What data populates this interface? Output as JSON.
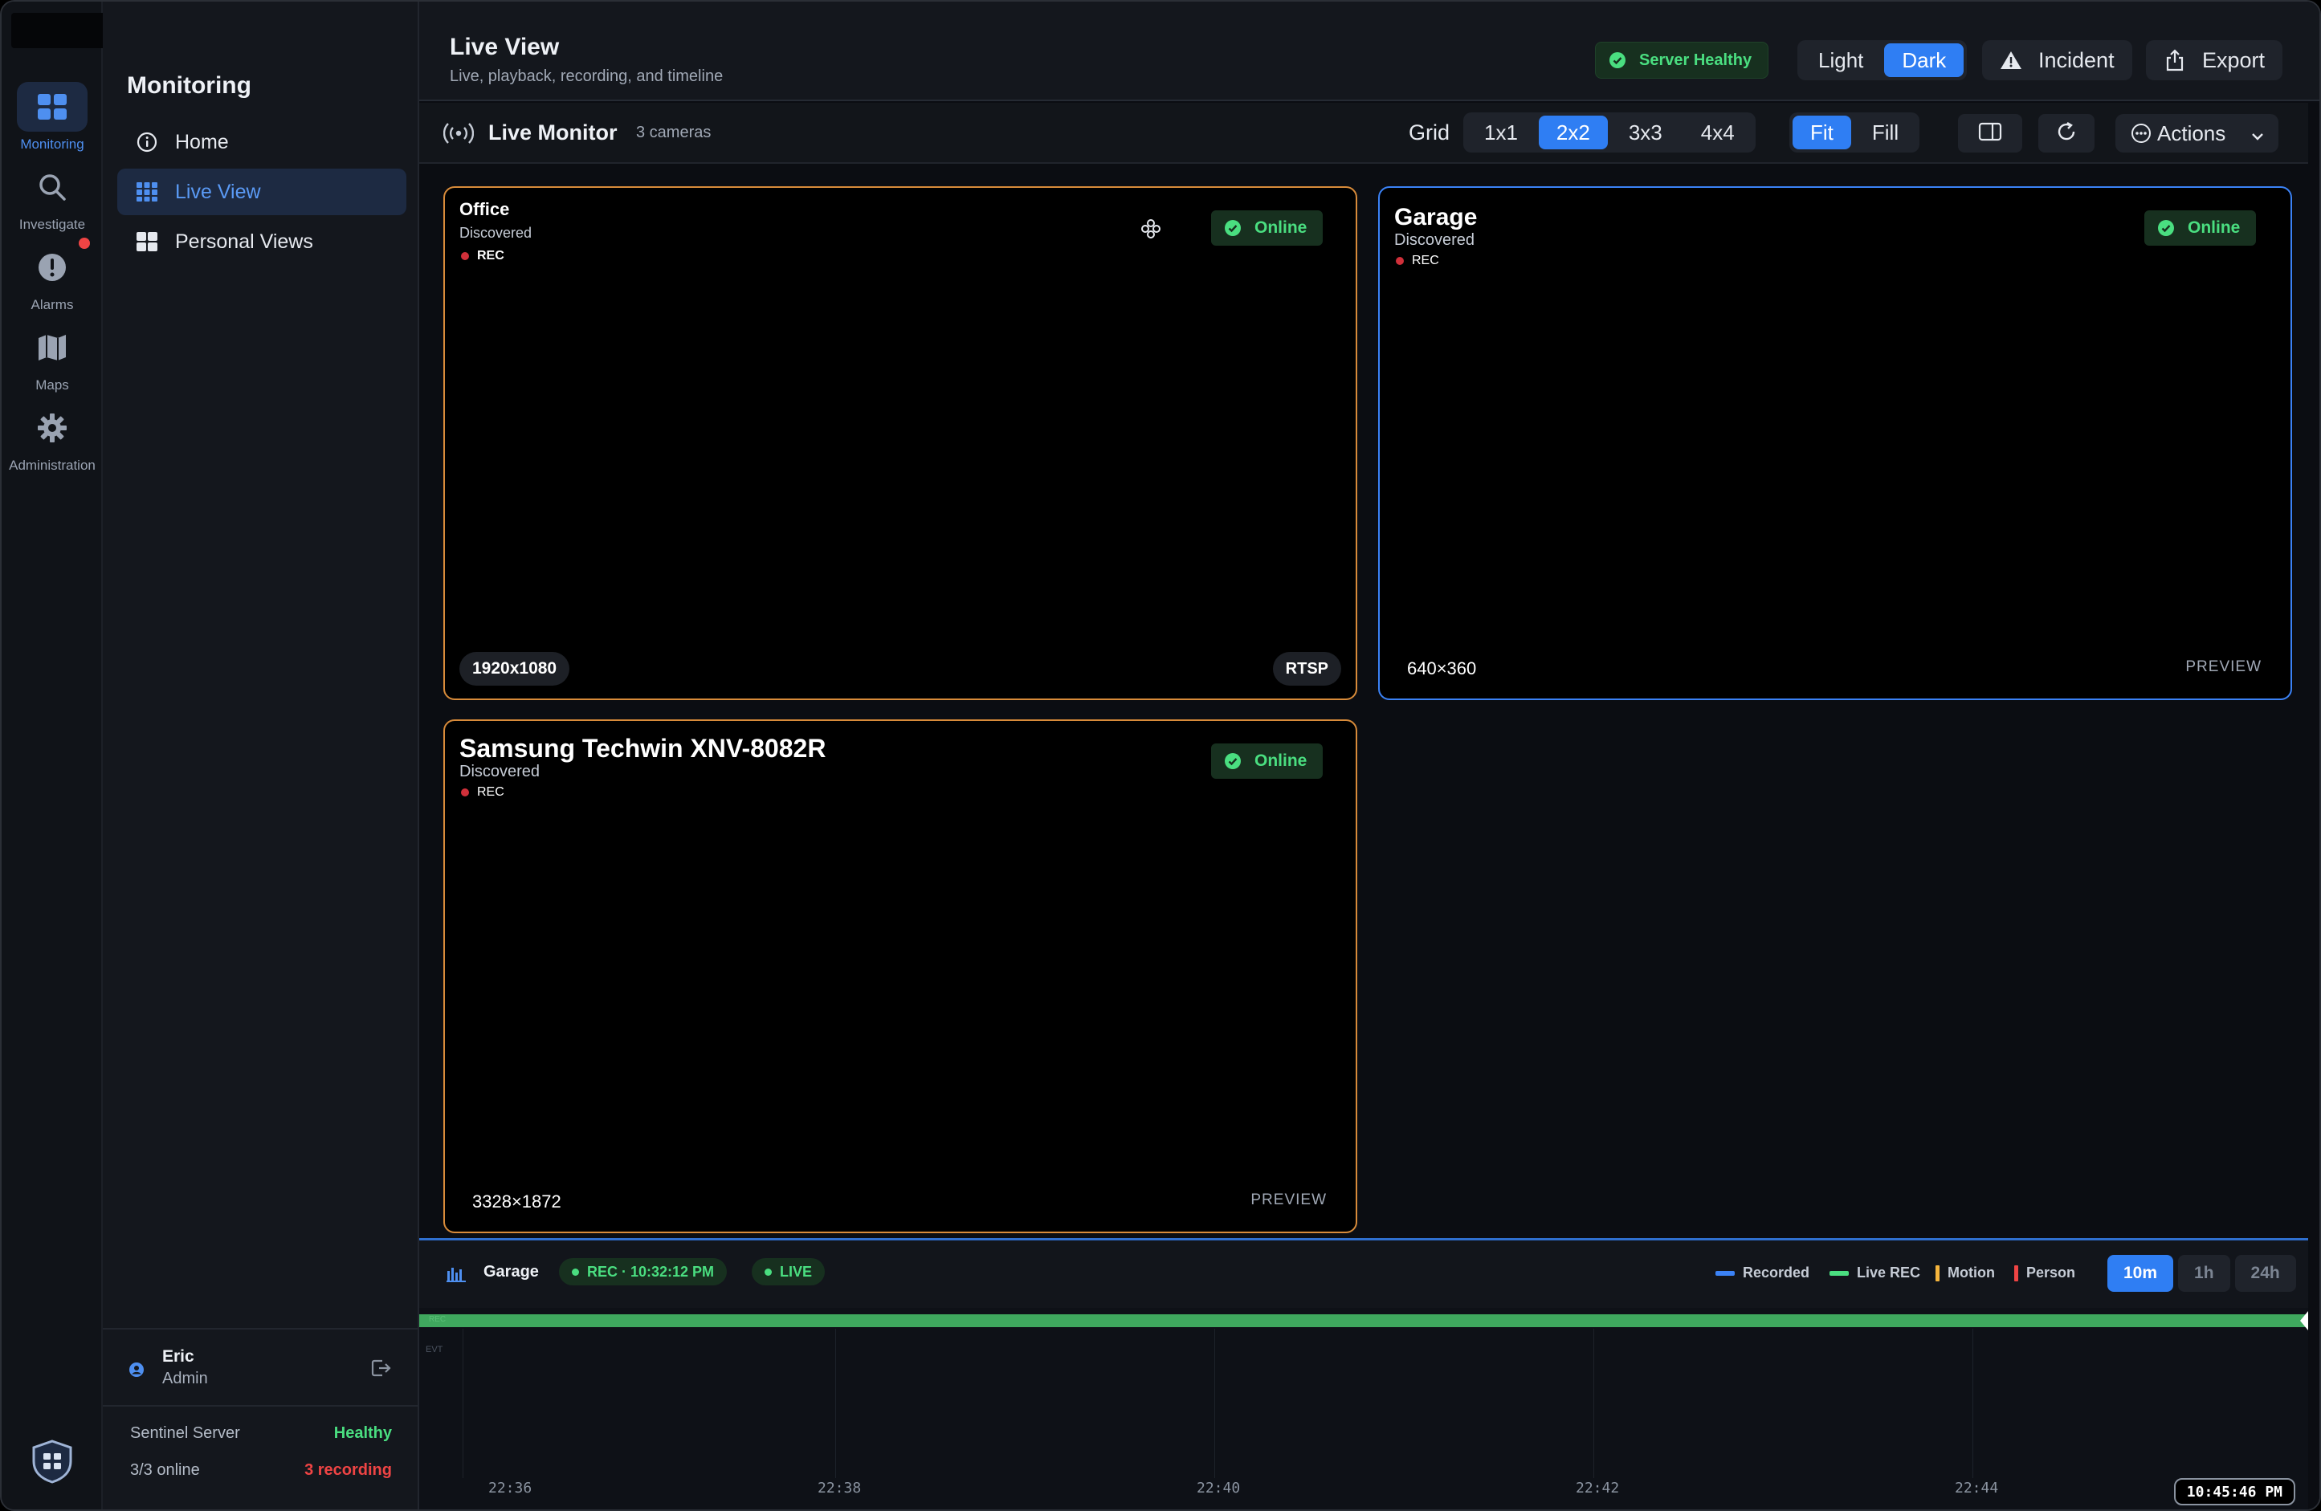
{
  "rail": {
    "items": [
      {
        "label": "Monitoring",
        "icon": "grid-icon",
        "active": true
      },
      {
        "label": "Investigate",
        "icon": "search-icon"
      },
      {
        "label": "Alarms",
        "icon": "alert-icon"
      },
      {
        "label": "Maps",
        "icon": "map-icon"
      },
      {
        "label": "Administration",
        "icon": "gear-icon"
      }
    ]
  },
  "sidebar": {
    "title": "Monitoring",
    "items": [
      {
        "label": "Home",
        "icon": "info-icon"
      },
      {
        "label": "Live View",
        "icon": "grid-icon",
        "active": true
      },
      {
        "label": "Personal Views",
        "icon": "grid-icon"
      }
    ],
    "user": {
      "name": "Eric",
      "role": "Admin"
    },
    "server": {
      "name": "Sentinel Server",
      "status": "Healthy",
      "online": "3/3 online",
      "recording": "3 recording"
    }
  },
  "header": {
    "title": "Live View",
    "subtitle": "Live, playback, recording, and timeline",
    "server_status": "Server Healthy",
    "theme": {
      "light": "Light",
      "dark": "Dark",
      "selected": "Dark"
    },
    "incident_label": "Incident",
    "export_label": "Export"
  },
  "toolbar": {
    "title": "Live Monitor",
    "camera_count": "3 cameras",
    "grid_label": "Grid",
    "grid_options": [
      "1x1",
      "2x2",
      "3x3",
      "4x4"
    ],
    "grid_selected": "2x2",
    "fit_options": [
      "Fit",
      "Fill"
    ],
    "fit_selected": "Fit",
    "actions_label": "Actions"
  },
  "cameras": [
    {
      "name": "Office",
      "source": "Discovered",
      "rec": "REC",
      "status": "Online",
      "resolution": "1920x1080",
      "protocol": "RTSP"
    },
    {
      "name": "Garage",
      "source": "Discovered",
      "rec": "REC",
      "status": "Online",
      "resolution": "640×360",
      "mode": "PREVIEW"
    },
    {
      "name": "Samsung Techwin XNV-8082R",
      "source": "Discovered",
      "rec": "REC",
      "status": "Online",
      "resolution": "3328×1872",
      "mode": "PREVIEW"
    }
  ],
  "timeline": {
    "camera": "Garage",
    "rec_pill": "REC · 10:32:12 PM",
    "live_pill": "LIVE",
    "legend": [
      {
        "label": "Recorded",
        "color": "#3b82f6"
      },
      {
        "label": "Live REC",
        "color": "#4ade80"
      },
      {
        "label": "Motion",
        "color": "#f5b53d"
      },
      {
        "label": "Person",
        "color": "#ef4444"
      }
    ],
    "ranges": [
      "10m",
      "1h",
      "24h"
    ],
    "range_selected": "10m",
    "bar_label": "REC",
    "evt_label": "EVT",
    "ticks": [
      "22:36",
      "22:38",
      "22:40",
      "22:42",
      "22:44"
    ],
    "clock": "10:45:46 PM"
  },
  "colors": {
    "accent": "#2f7ef3",
    "healthy": "#4ade80",
    "alert": "#ef4444",
    "tile_border_active": "#d88b3a"
  }
}
